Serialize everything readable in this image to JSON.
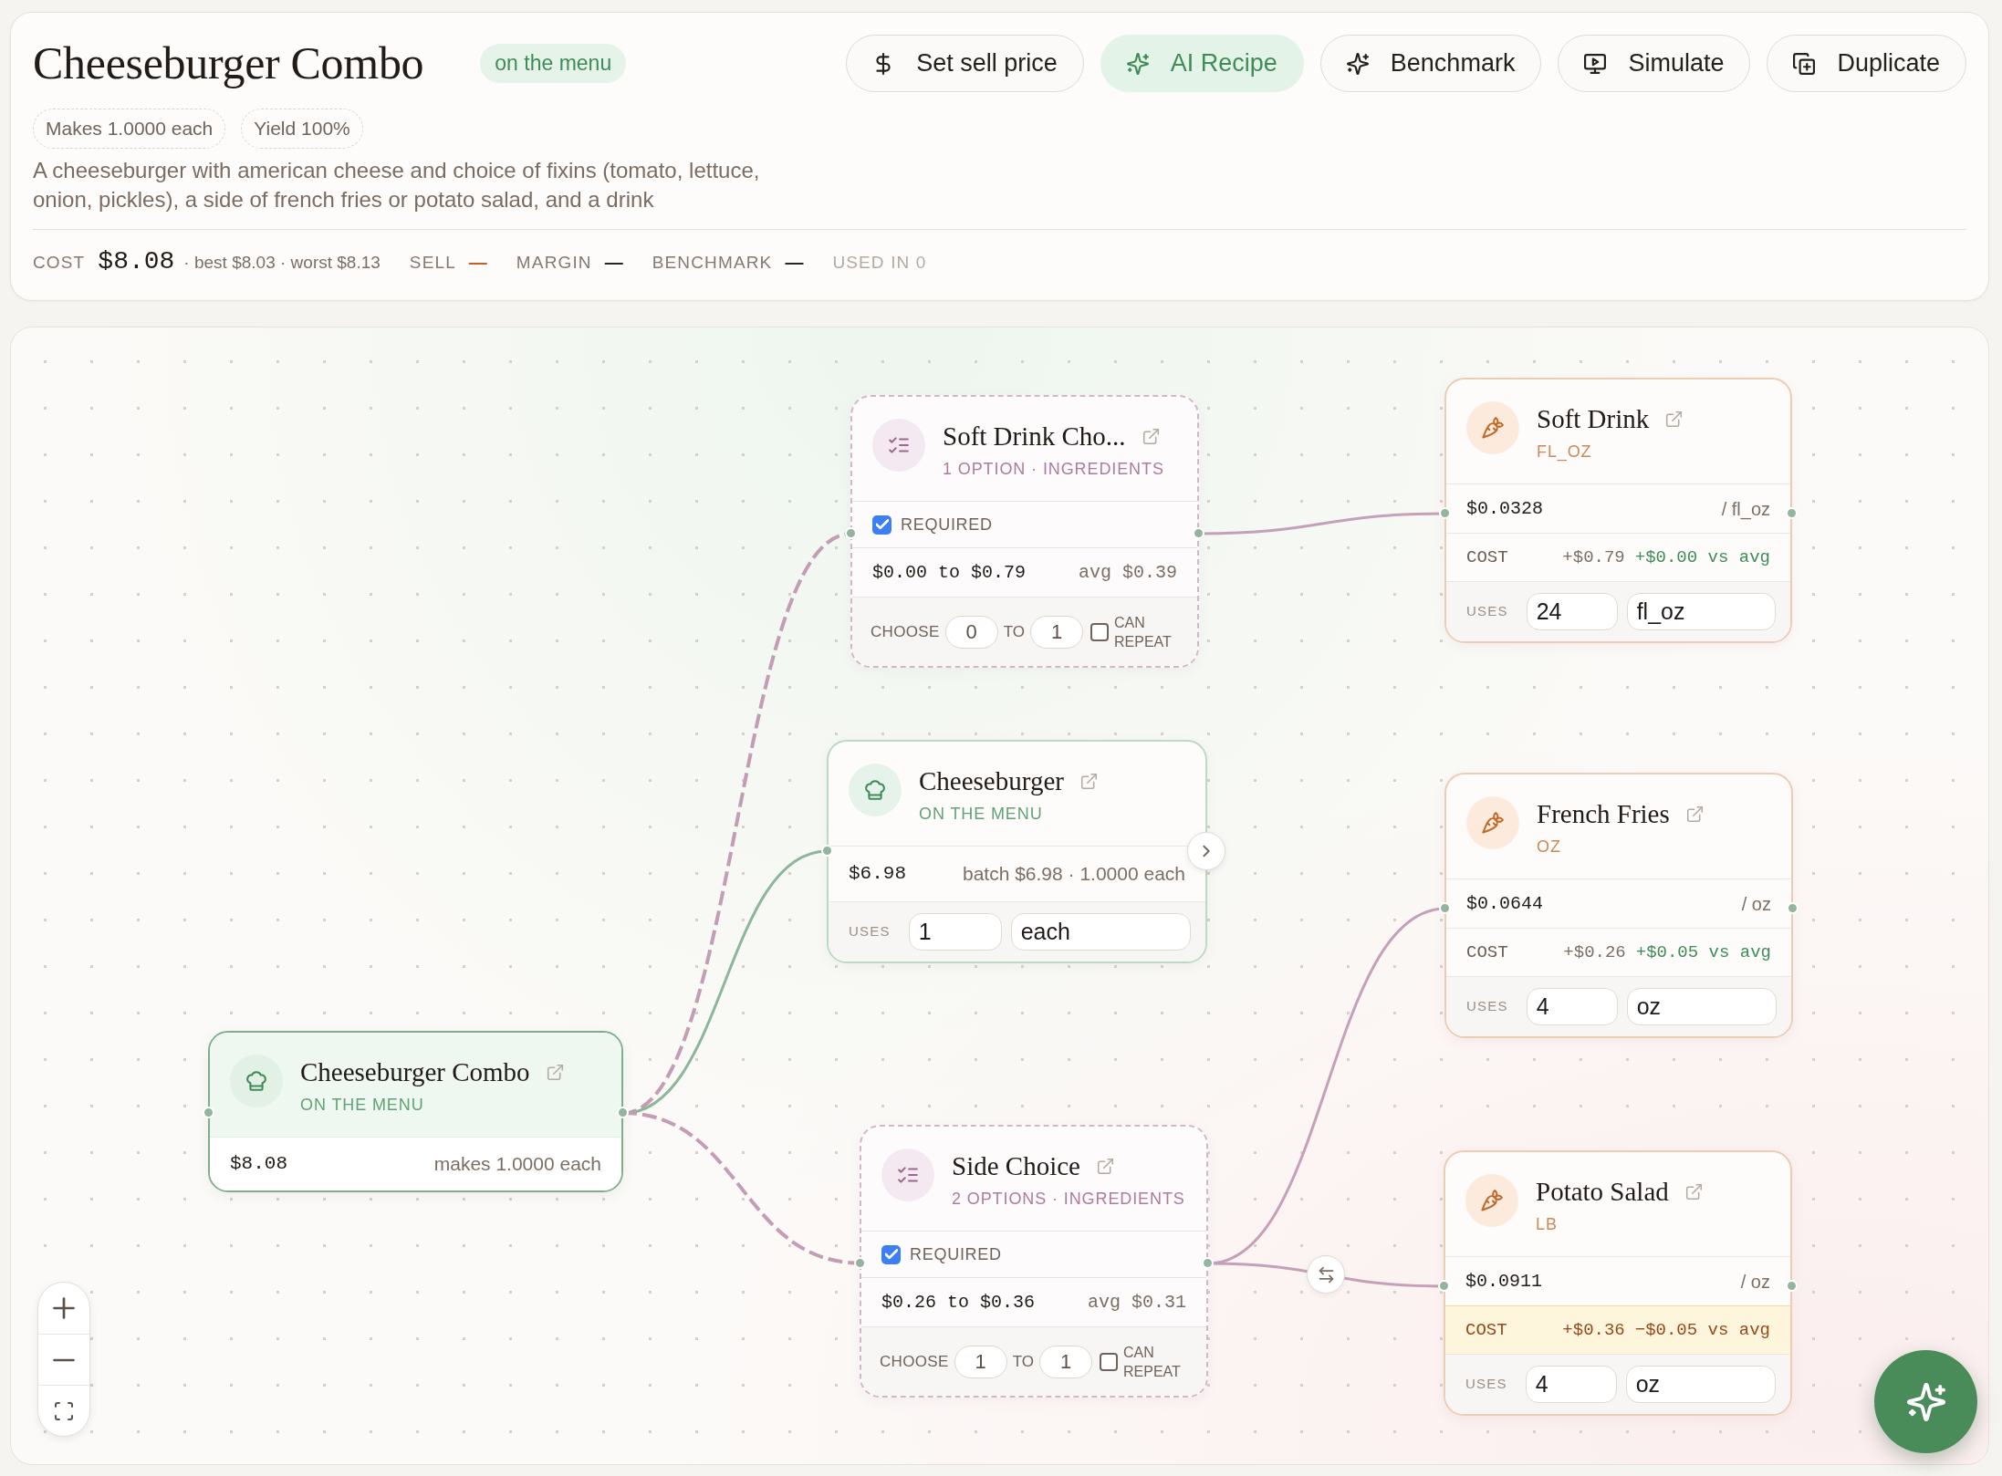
{
  "header": {
    "title": "Cheeseburger Combo",
    "status": "on the menu",
    "actions": [
      {
        "label": "Set sell price",
        "highlighted": false
      },
      {
        "label": "AI Recipe",
        "highlighted": true
      },
      {
        "label": "Benchmark",
        "highlighted": false
      },
      {
        "label": "Simulate",
        "highlighted": false
      },
      {
        "label": "Duplicate",
        "highlighted": false
      }
    ],
    "chips": [
      "Makes 1.0000 each",
      "Yield 100%"
    ],
    "description": "A cheeseburger with american cheese and choice of fixins (tomato, lettuce, onion, pickles), a side of french fries or potato salad, and a drink",
    "stats": [
      {
        "kind": "figure",
        "label": "COST",
        "value": "$8.08",
        "detail": "· best $8.03 · worst $8.13",
        "alert": false
      },
      {
        "kind": "pending",
        "label": "SELL",
        "value": "—",
        "alert": true
      },
      {
        "kind": "pending",
        "label": "MARGIN",
        "value": "—",
        "alert": false
      },
      {
        "kind": "pending",
        "label": "BENCHMARK",
        "value": "—",
        "alert": false
      },
      {
        "kind": "note",
        "label": "USED IN 0",
        "alert": false
      }
    ]
  },
  "canvas": {
    "nodes": [
      {
        "kind": "root_recipe",
        "title": "Cheeseburger Combo",
        "subtitle": "ON THE MENU",
        "price": "$8.08",
        "detail": "makes 1.0000 each",
        "children": [
          {
            "kind": "choice",
            "title": "Soft Drink Cho...",
            "subtitle": "1 OPTION · INGREDIENTS",
            "required_label": "REQUIRED",
            "required": true,
            "range": "$0.00 to $0.79",
            "average": "avg $0.39",
            "choose_label": "CHOOSE",
            "min": "0",
            "to_label": "TO",
            "max": "1",
            "can_repeat": false,
            "can_repeat_label": "CAN REPEAT",
            "children": [
              {
                "kind": "ingredient",
                "title": "Soft Drink",
                "unit_label": "FL_OZ",
                "price": "$0.0328",
                "per_unit": "/ fl_oz",
                "cost_label": "COST",
                "cost": "+$0.79",
                "vs_avg": "+$0.00 vs avg",
                "highlighted": false,
                "uses_label": "USES",
                "quantity": "24",
                "unit": "fl_oz",
                "swappable": false
              }
            ]
          },
          {
            "kind": "recipe",
            "title": "Cheeseburger",
            "subtitle": "ON THE MENU",
            "price": "$6.98",
            "detail": "batch $6.98 · 1.0000 each",
            "uses_label": "USES",
            "quantity": "1",
            "unit": "each"
          },
          {
            "kind": "choice",
            "title": "Side Choice",
            "subtitle": "2 OPTIONS · INGREDIENTS",
            "required_label": "REQUIRED",
            "required": true,
            "range": "$0.26 to $0.36",
            "average": "avg $0.31",
            "choose_label": "CHOOSE",
            "min": "1",
            "to_label": "TO",
            "max": "1",
            "can_repeat": false,
            "can_repeat_label": "CAN REPEAT",
            "children": [
              {
                "kind": "ingredient",
                "title": "French Fries",
                "unit_label": "OZ",
                "price": "$0.0644",
                "per_unit": "/ oz",
                "cost_label": "COST",
                "cost": "+$0.26",
                "vs_avg": "+$0.05 vs avg",
                "highlighted": false,
                "uses_label": "USES",
                "quantity": "4",
                "unit": "oz",
                "swappable": false
              },
              {
                "kind": "ingredient",
                "title": "Potato Salad",
                "unit_label": "LB",
                "price": "$0.0911",
                "per_unit": "/ oz",
                "cost_label": "COST",
                "cost": "+$0.36",
                "vs_avg": "−$0.05 vs avg",
                "highlighted": true,
                "uses_label": "USES",
                "quantity": "4",
                "unit": "oz",
                "swappable": true
              }
            ]
          }
        ]
      }
    ]
  }
}
